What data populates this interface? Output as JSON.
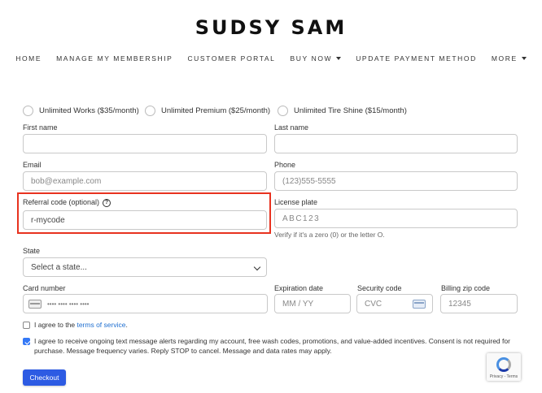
{
  "brand": "SUDSY SAM",
  "nav": [
    "HOME",
    "MANAGE MY MEMBERSHIP",
    "CUSTOMER PORTAL",
    "BUY NOW",
    "UPDATE PAYMENT METHOD",
    "MORE"
  ],
  "plans": [
    "Unlimited Works ($35/month)",
    "Unlimited Premium ($25/month)",
    "Unlimited Tire Shine ($15/month)"
  ],
  "form": {
    "first_name_label": "First name",
    "last_name_label": "Last name",
    "email_label": "Email",
    "email_placeholder": "bob@example.com",
    "phone_label": "Phone",
    "phone_placeholder": "(123)555-5555",
    "referral_label": "Referral code (optional)",
    "help_glyph": "?",
    "referral_value": "r-mycode",
    "plate_label": "License plate",
    "plate_placeholder": "ABC123",
    "plate_hint": "Verify if it's a zero (0) or the letter O.",
    "state_label": "State",
    "state_value": "Select a state...",
    "card_label": "Card number",
    "card_placeholder": "•••• •••• •••• ••••",
    "exp_label": "Expiration date",
    "exp_placeholder": "MM / YY",
    "cvc_label": "Security code",
    "cvc_placeholder": "CVC",
    "zip_label": "Billing zip code",
    "zip_placeholder": "12345"
  },
  "terms": {
    "prefix": "I agree to the ",
    "link": "terms of service",
    "suffix": ".",
    "checked": false
  },
  "sms": {
    "text": "I agree to receive ongoing text message alerts regarding my account, free wash codes, promotions, and value-added incentives. Consent is not required for purchase. Message frequency varies. Reply STOP to cancel. Message and data rates may apply.",
    "checked": true
  },
  "checkout_label": "Checkout",
  "recaptcha_text": "Privacy - Terms",
  "colors": {
    "highlight": "#e8321f",
    "button": "#2d5be3",
    "link": "#1f6fd0"
  }
}
